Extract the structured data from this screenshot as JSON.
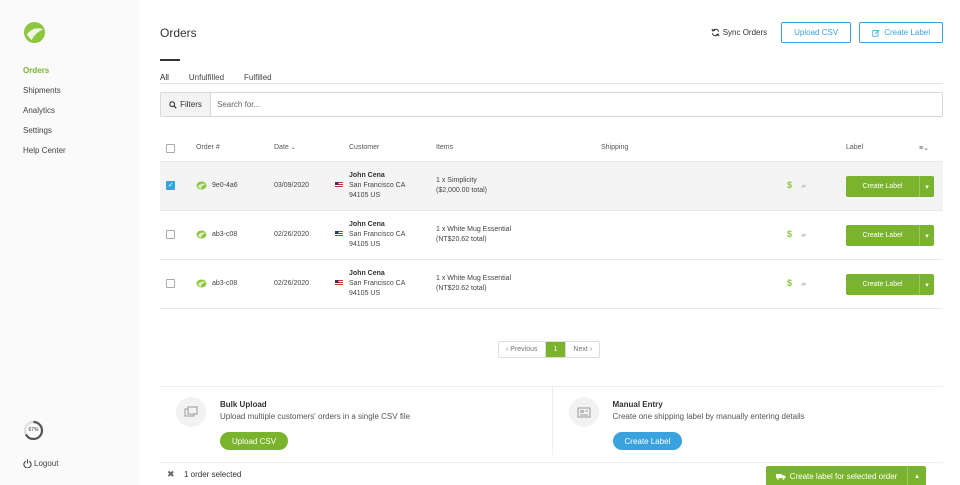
{
  "sidebar": {
    "items": [
      {
        "label": "Orders",
        "active": true
      },
      {
        "label": "Shipments"
      },
      {
        "label": "Analytics"
      },
      {
        "label": "Settings"
      },
      {
        "label": "Help Center"
      }
    ],
    "usage_percent": "67%",
    "logout_label": "Logout"
  },
  "header": {
    "title": "Orders",
    "sync_label": "Sync Orders",
    "upload_csv_label": "Upload CSV",
    "create_label_label": "Create Label"
  },
  "tabs": [
    {
      "label": "All",
      "active": true
    },
    {
      "label": "Unfulfilled"
    },
    {
      "label": "Fulfilled"
    }
  ],
  "filter": {
    "button_label": "Filters",
    "search_placeholder": "Search for..."
  },
  "table": {
    "headers": {
      "order": "Order #",
      "date": "Date",
      "customer": "Customer",
      "items": "Items",
      "shipping": "Shipping",
      "label": "Label"
    },
    "rows": [
      {
        "order": "9e0-4a6",
        "date": "03/09/2020",
        "customer_name": "John Cena",
        "customer_city": "San Francisco CA",
        "customer_zip": "94105 US",
        "items_line1": "1 x Simplicity",
        "items_line2": "($2,000.00 total)",
        "shipping_price_icon": "$",
        "action_label": "Create Label",
        "selected": true
      },
      {
        "order": "ab3-c08",
        "date": "02/26/2020",
        "customer_name": "John Cena",
        "customer_city": "San Francisco CA",
        "customer_zip": "94105 US",
        "items_line1": "1 x White Mug Essential",
        "items_line2": "(NT$20.62 total)",
        "shipping_price_icon": "$",
        "action_label": "Create Label",
        "selected": false
      },
      {
        "order": "ab3-c08",
        "date": "02/26/2020",
        "customer_name": "John Cena",
        "customer_city": "San Francisco CA",
        "customer_zip": "94105 US",
        "items_line1": "1 x White Mug Essential",
        "items_line2": "(NT$20.62 total)",
        "shipping_price_icon": "$",
        "action_label": "Create Label",
        "selected": false
      }
    ]
  },
  "pagination": {
    "previous": "‹ Previous",
    "current": "1",
    "next": "Next ›"
  },
  "cards": {
    "bulk": {
      "title": "Bulk Upload",
      "description": "Upload multiple customers' orders in a single CSV file",
      "button": "Upload CSV"
    },
    "manual": {
      "title": "Manual Entry",
      "description": "Create one shipping label by manually entering details",
      "button": "Create Label"
    }
  },
  "footer": {
    "selected_count": "1 order selected",
    "bulk_action": "Create label for selected order"
  },
  "colors": {
    "brand_green": "#7ab32e",
    "accent_blue": "#3aa3dd"
  }
}
